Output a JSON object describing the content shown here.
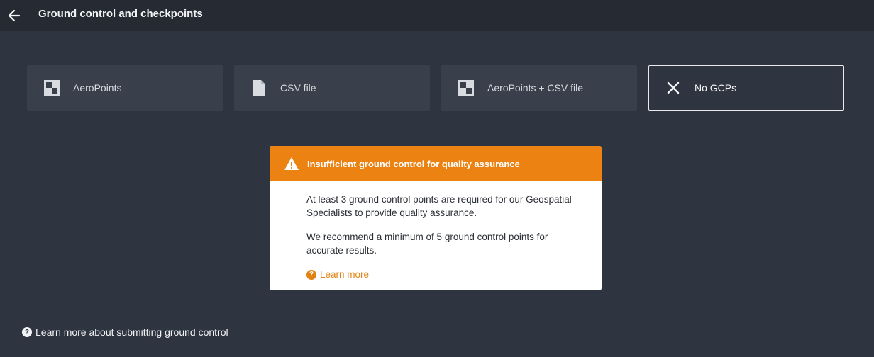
{
  "header": {
    "title": "Ground control and checkpoints",
    "back_icon": "arrow-left-icon"
  },
  "options": [
    {
      "label": "AeroPoints",
      "icon": "aeropoint-icon",
      "selected": false
    },
    {
      "label": "CSV file",
      "icon": "file-icon",
      "selected": false
    },
    {
      "label": "AeroPoints + CSV file",
      "icon": "aeropoint-icon",
      "selected": false
    },
    {
      "label": "No GCPs",
      "icon": "close-icon",
      "selected": true
    }
  ],
  "alert": {
    "title": "Insufficient ground control for quality assurance",
    "paragraph1": "At least 3 ground control points are required for our Geospatial Specialists to provide quality assurance.",
    "paragraph2": "We recommend a minimum of 5 ground control points for accurate results.",
    "learn_more": "Learn more",
    "accent_color": "#ec8212"
  },
  "footer": {
    "help_link": "Learn more about submitting ground control"
  },
  "colors": {
    "background": "#2e3440",
    "topbar": "#252a33",
    "card": "#3a404b"
  }
}
